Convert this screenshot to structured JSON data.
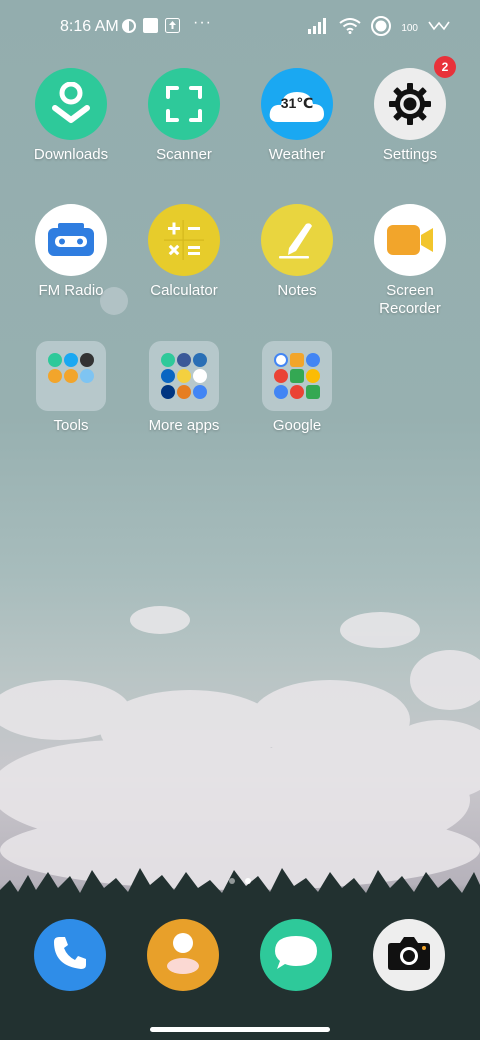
{
  "status_bar": {
    "time": "8:16 AM",
    "more_indicator": "···",
    "battery_level": "100",
    "icons": [
      "notification-icon",
      "square-icon",
      "upload-icon",
      "signal-icon",
      "wifi-icon",
      "record-icon",
      "data-speed-icon"
    ]
  },
  "apps": [
    {
      "label": "Downloads",
      "icon": "download-icon",
      "color": "#2ec99a"
    },
    {
      "label": "Scanner",
      "icon": "scan-icon",
      "color": "#2ec99a"
    },
    {
      "label": "Weather",
      "icon": "cloud-icon",
      "color": "#1aa8f2",
      "temp": "31℃"
    },
    {
      "label": "Settings",
      "icon": "gear-icon",
      "color": "#ededed",
      "badge": "2"
    },
    {
      "label": "FM Radio",
      "icon": "radio-icon",
      "color": "#ffffff"
    },
    {
      "label": "Calculator",
      "icon": "calculator-icon",
      "color": "#e7cc2b"
    },
    {
      "label": "Notes",
      "icon": "pen-icon",
      "color": "#e9d53f"
    },
    {
      "label": "Screen Recorder",
      "icon": "video-icon",
      "color": "#ffffff"
    }
  ],
  "folders": [
    {
      "label": "Tools"
    },
    {
      "label": "More apps"
    },
    {
      "label": "Google"
    }
  ],
  "page_indicator": {
    "count": 2,
    "active": 2
  },
  "dock": [
    {
      "name": "phone",
      "icon": "phone-icon",
      "color": "#2f8de8"
    },
    {
      "name": "contacts",
      "icon": "person-icon",
      "color": "#e8a02a"
    },
    {
      "name": "messages",
      "icon": "chat-icon",
      "color": "#2ec99a"
    },
    {
      "name": "camera",
      "icon": "camera-icon",
      "color": "#eeeeee"
    }
  ]
}
